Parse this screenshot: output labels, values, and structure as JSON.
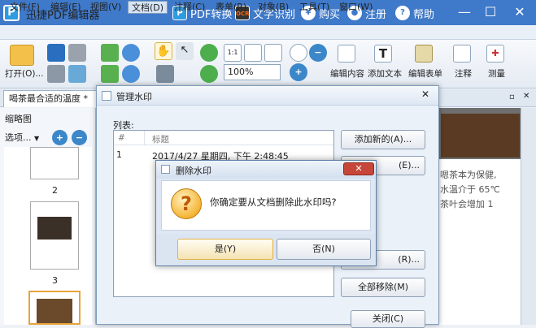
{
  "app": {
    "title": "迅捷PDF编辑器",
    "logo_letter": "P",
    "tools": [
      {
        "label": "PDF转换",
        "icon": "pdf-convert-icon"
      },
      {
        "label": "文字识别",
        "icon": "ocr-icon"
      },
      {
        "label": "购买",
        "icon": "yen-icon"
      },
      {
        "label": "注册",
        "icon": "user-icon"
      },
      {
        "label": "帮助",
        "icon": "help-icon"
      }
    ],
    "ocr_badge": "OCR"
  },
  "menu": [
    "文件(F)",
    "编辑(E)",
    "视图(V)",
    "文档(D)",
    "注释(C)",
    "表单(R)",
    "对象(B)",
    "工具(T)",
    "窗口(W)"
  ],
  "toolbar": {
    "open_label": "打开(O)...",
    "zoom_value": "100%",
    "page_size_label": "1:1",
    "edit_content": "编辑内容",
    "add_text": "添加文本",
    "edit_form": "编辑表单",
    "annotate": "注释",
    "measure": "测量"
  },
  "tab": {
    "label": "喝茶最合适的温度 *"
  },
  "left_panel": {
    "title": "缩略图",
    "options": "选项...",
    "page_numbers": [
      "2",
      "3"
    ]
  },
  "doc_text": [
    "嗯茶本为保健,",
    "水温介于 65℃",
    "茶叶会增加 1"
  ],
  "manage_dialog": {
    "title": "管理水印",
    "list_label": "列表:",
    "columns": [
      "#",
      "标题"
    ],
    "rows": [
      {
        "num": "1",
        "title": "2017/4/27 星期四, 下午 2:48:45"
      }
    ],
    "buttons": {
      "add": "添加新的(A)...",
      "edit": "编辑(E)...",
      "delete": "删除(R)...",
      "remove_all": "全部移除(M)",
      "close": "关闭(C)"
    },
    "edit_visible": "(E)...",
    "delete_visible": "(R)..."
  },
  "delete_dialog": {
    "title": "删除水印",
    "message": "你确定要从文档删除此水印吗?",
    "yes": "是(Y)",
    "no": "否(N)"
  }
}
